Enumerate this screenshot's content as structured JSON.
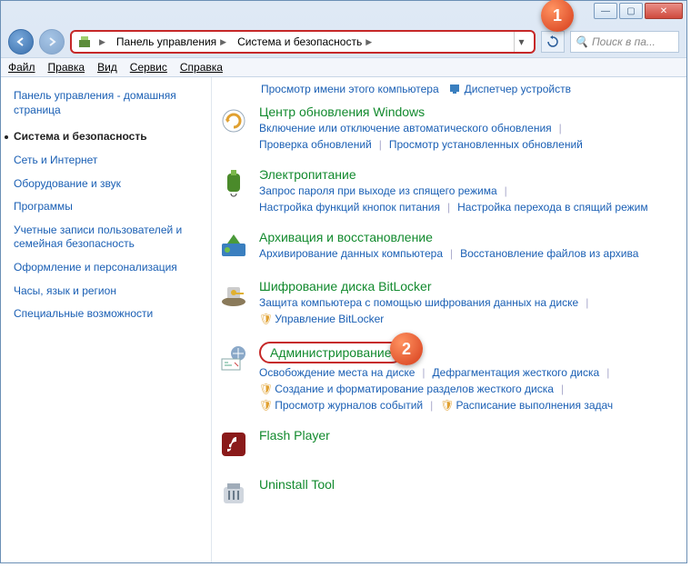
{
  "titlebar": {
    "min": "—",
    "max": "▢",
    "close": "✕"
  },
  "breadcrumb": {
    "root_glyph": "▶",
    "items": [
      "Панель управления",
      "Система и безопасность"
    ]
  },
  "search": {
    "placeholder": "Поиск в па..."
  },
  "menubar": [
    "Файл",
    "Правка",
    "Вид",
    "Сервис",
    "Справка"
  ],
  "sidebar": {
    "home": "Панель управления - домашняя страница",
    "items": [
      {
        "label": "Система и безопасность",
        "active": true
      },
      {
        "label": "Сеть и Интернет"
      },
      {
        "label": "Оборудование и звук"
      },
      {
        "label": "Программы"
      },
      {
        "label": "Учетные записи пользователей и семейная безопасность"
      },
      {
        "label": "Оформление и персонализация"
      },
      {
        "label": "Часы, язык и регион"
      },
      {
        "label": "Специальные возможности"
      }
    ]
  },
  "top_links": [
    "Просмотр имени этого компьютера",
    "Диспетчер устройств"
  ],
  "groups": [
    {
      "icon": "windows-update-icon",
      "title": "Центр обновления Windows",
      "links": [
        {
          "t": "Включение или отключение автоматического обновления"
        },
        {
          "t": "Проверка обновлений"
        },
        {
          "t": "Просмотр установленных обновлений"
        }
      ]
    },
    {
      "icon": "power-icon",
      "title": "Электропитание",
      "links": [
        {
          "t": "Запрос пароля при выходе из спящего режима"
        },
        {
          "t": "Настройка функций кнопок питания"
        },
        {
          "t": "Настройка перехода в спящий режим"
        }
      ]
    },
    {
      "icon": "backup-icon",
      "title": "Архивация и восстановление",
      "links": [
        {
          "t": "Архивирование данных компьютера"
        },
        {
          "t": "Восстановление файлов из архива"
        }
      ]
    },
    {
      "icon": "bitlocker-icon",
      "title": "Шифрование диска BitLocker",
      "links": [
        {
          "t": "Защита компьютера с помощью шифрования данных на диске"
        },
        {
          "t": "Управление BitLocker",
          "shield": true
        }
      ]
    },
    {
      "icon": "admin-tools-icon",
      "title": "Администрирование",
      "highlight": true,
      "links": [
        {
          "t": "Освобождение места на диске"
        },
        {
          "t": "Дефрагментация жесткого диска"
        },
        {
          "t": "Создание и форматирование разделов жесткого диска",
          "shield": true
        },
        {
          "t": "Просмотр журналов событий",
          "shield": true
        },
        {
          "t": "Расписание выполнения задач",
          "shield": true
        }
      ]
    },
    {
      "icon": "flash-icon",
      "title": "Flash Player",
      "links": []
    },
    {
      "icon": "uninstall-icon",
      "title": "Uninstall Tool",
      "links": []
    }
  ],
  "callouts": {
    "one": "1",
    "two": "2"
  }
}
